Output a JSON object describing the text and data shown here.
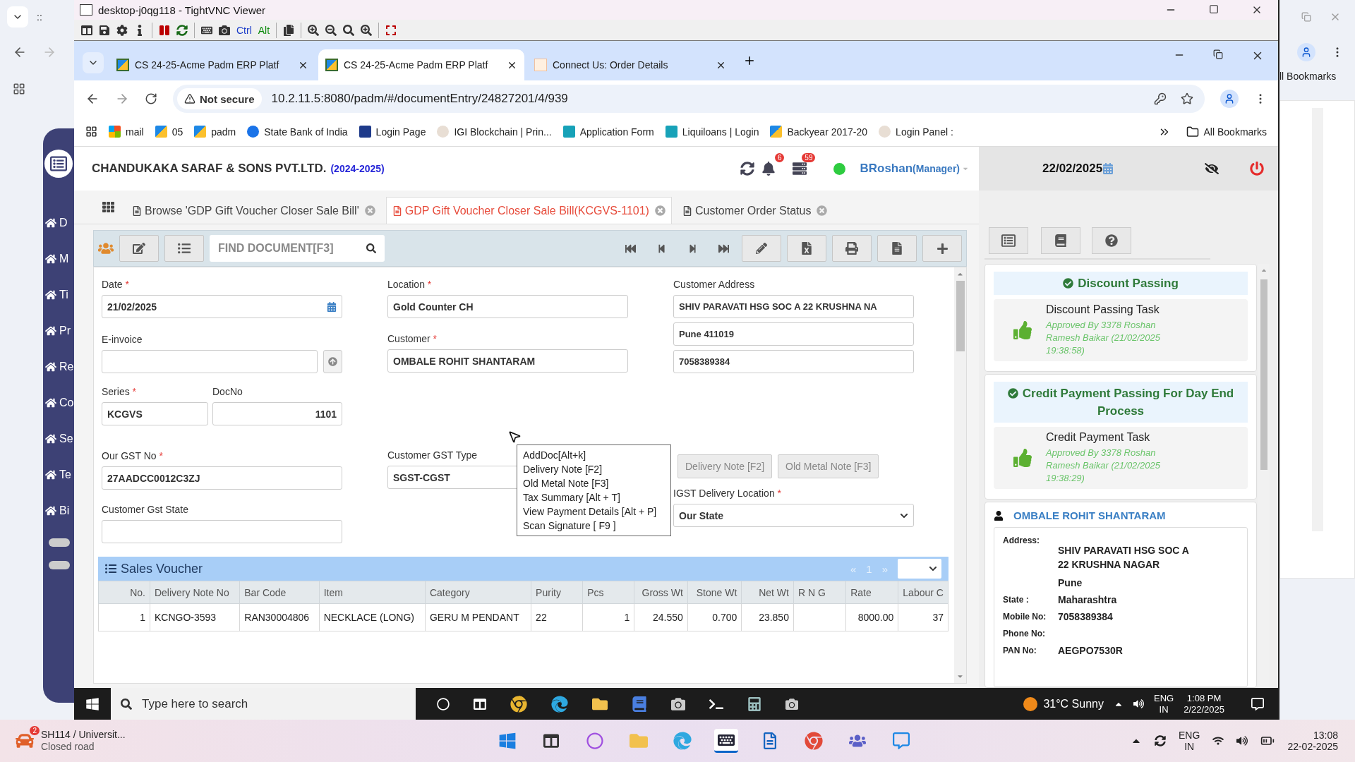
{
  "host": {
    "tab_title": "::",
    "sidebar_items": [
      {
        "label": "D"
      },
      {
        "label": "M"
      },
      {
        "label": "Ti"
      },
      {
        "label": "Pr"
      },
      {
        "label": "Re"
      },
      {
        "label": "Co"
      },
      {
        "label": "Se"
      },
      {
        "label": "Te"
      },
      {
        "label": "Bi"
      }
    ],
    "toggles": [
      {
        "on": false
      },
      {
        "on": false
      }
    ],
    "bookmarks_label": "ll Bookmarks"
  },
  "vnc": {
    "title": "desktop-j0qg118 - TightVNC Viewer",
    "keys": [
      "Ctrl",
      "Alt"
    ]
  },
  "browser": {
    "tabs": [
      {
        "title": "CS 24-25-Acme Padm ERP Platf",
        "selected": false,
        "kind": "app"
      },
      {
        "title": "CS 24-25-Acme Padm ERP Platf",
        "selected": true,
        "kind": "app"
      },
      {
        "title": "Connect Us: Order Details",
        "selected": false,
        "kind": "web"
      }
    ],
    "security": "Not secure",
    "url": "10.2.11.5:8080/padm/#/documentEntry/24827201/4/939",
    "bookmarks": [
      {
        "label": "mail",
        "kind": "ms"
      },
      {
        "label": "05",
        "kind": "app"
      },
      {
        "label": "padm",
        "kind": "app"
      },
      {
        "label": "State Bank of India",
        "kind": "bank"
      },
      {
        "label": "Login Page",
        "kind": "p"
      },
      {
        "label": "IGI Blockchain | Prin...",
        "kind": "seal"
      },
      {
        "label": "Application Form",
        "kind": "doc"
      },
      {
        "label": "Liquiloans | Login",
        "kind": "doc"
      },
      {
        "label": "Backyear 2017-20",
        "kind": "app"
      },
      {
        "label": "Login Panel :",
        "kind": "seal"
      }
    ],
    "all_bookmarks": "All Bookmarks"
  },
  "app": {
    "company": "CHANDUKAKA SARAF & SONS PVT.LTD.",
    "year": "(2024-2025)",
    "notifications": "6",
    "messages": "59",
    "online": true,
    "user": "BRoshan",
    "role": "(Manager)",
    "date": "22/02/2025",
    "doc_tabs": [
      {
        "label": "Browse 'GDP Gift Voucher Closer Sale Bill'",
        "selected": false
      },
      {
        "label": "GDP Gift Voucher Closer Sale Bill(KCGVS-1101)",
        "selected": true
      },
      {
        "label": "Customer Order Status",
        "selected": false
      }
    ],
    "find_placeholder": "FIND DOCUMENT[F3]",
    "form": {
      "required_mark": "*",
      "columns": [
        [
          {
            "kind": "date",
            "label": "Date",
            "required": true,
            "value": "21/02/2025"
          },
          {
            "kind": "upload",
            "label": "E-invoice",
            "required": false
          },
          {
            "kind": "pair",
            "items": [
              {
                "label": "Series",
                "required": true,
                "value": "KCGVS"
              },
              {
                "label": "DocNo",
                "required": false,
                "value": "1101"
              }
            ]
          },
          {
            "kind": "text",
            "label": "Our GST No",
            "required": true,
            "value": "27AADCC0012C3ZJ"
          },
          {
            "kind": "text",
            "label": "Customer Gst State",
            "required": false
          }
        ],
        [
          {
            "kind": "text",
            "label": "Location",
            "required": true,
            "value": "Gold Counter CH"
          },
          {
            "kind": "text",
            "label": "Customer",
            "required": true,
            "value": "OMBALE ROHIT SHANTARAM"
          },
          {
            "kind": "text",
            "label": "Customer GST Type",
            "required": false,
            "value": "SGST-CGST"
          }
        ],
        [
          {
            "kind": "address",
            "label": "Customer Address",
            "required": false,
            "lines": [
              "SHIV PARAVATI HSG SOC A 22 KRUSHNA NA",
              "Pune 411019",
              "7058389384"
            ]
          },
          {
            "kind": "buttons",
            "buttons": [
              {
                "label": "Delivery Note [F2]",
                "disabled": true
              },
              {
                "label": "Old Metal Note [F3]",
                "disabled": true
              }
            ]
          },
          {
            "kind": "select",
            "label": "IGST Delivery Location",
            "required": true,
            "value": "Our State"
          }
        ]
      ]
    },
    "context_menu": [
      "AddDoc[Alt+k]",
      "Delivery Note [F2]",
      "Old Metal Note [F3]",
      "Tax Summary [Alt + T]",
      "View Payment Details [Alt + P]",
      "Scan Signature [ F9 ]"
    ],
    "sales_voucher": {
      "title": "Sales Voucher",
      "prev": "«",
      "page": "1",
      "next": "»",
      "columns": [
        "No.",
        "Delivery Note No",
        "Bar Code",
        "Item",
        "Category",
        "Purity",
        "Pcs",
        "Gross Wt",
        "Stone Wt",
        "Net Wt",
        "R N G",
        "Rate",
        "Labour C"
      ],
      "rows": [
        [
          "1",
          "KCNGO-3593",
          "RAN30004806",
          "NECKLACE (LONG)",
          "GERU M PENDANT",
          "22",
          "1",
          "24.550",
          "0.700",
          "23.850",
          "",
          "8000.00",
          "37"
        ]
      ]
    },
    "side": {
      "approvals": [
        {
          "title": "Discount Passing",
          "task": "Discount Passing Task",
          "note": "Approved By 3378 Roshan Ramesh Baikar (21/02/2025 19:38:58)"
        },
        {
          "title": "Credit Payment Passing For Day End Process",
          "task": "Credit Payment Task",
          "note": "Approved By 3378 Roshan Ramesh Baikar (21/02/2025 19:38:29)"
        }
      ],
      "customer": {
        "name": "OMBALE ROHIT SHANTARAM",
        "details": [
          {
            "label": "Address:",
            "values": [
              "SHIV PARAVATI HSG SOC A 22 KRUSHNA NAGAR",
              "Pune"
            ]
          },
          {
            "label": "State :",
            "values": [
              "Maharashtra"
            ]
          },
          {
            "label": "Mobile No:",
            "values": [
              "7058389384"
            ]
          },
          {
            "label": "Phone No:"
          },
          {
            "label": "PAN No:",
            "values": [
              "AEGPO7530R"
            ]
          }
        ]
      }
    }
  },
  "remote_taskbar": {
    "search_placeholder": "Type here to search",
    "weather": "31°C Sunny",
    "lang": [
      "ENG",
      "IN"
    ],
    "time": "1:08 PM",
    "date": "2/22/2025"
  },
  "host_taskbar": {
    "news_badge": "2",
    "news_title": "SH114 / Universit...",
    "news_subtitle": "Closed road",
    "lang": [
      "ENG",
      "IN"
    ],
    "time": "13:08",
    "date": "22-02-2025"
  }
}
